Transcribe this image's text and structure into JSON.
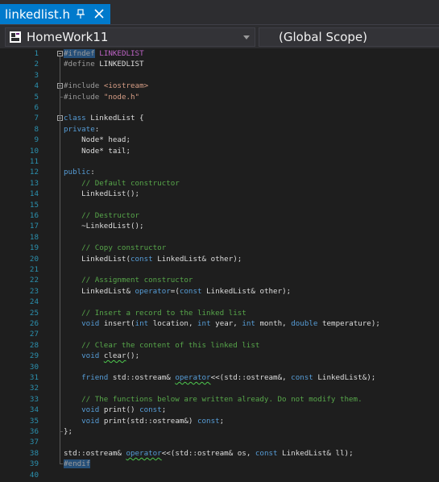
{
  "tab": {
    "title": "linkedlist.h"
  },
  "nav": {
    "project": "HomeWork11",
    "scope": "(Global Scope)"
  },
  "lines": [
    {
      "n": "1",
      "segs": [
        {
          "t": "#ifndef",
          "c": "pp sel"
        },
        {
          "t": " "
        },
        {
          "t": "LINKEDLIST",
          "c": "macro"
        }
      ]
    },
    {
      "n": "2",
      "segs": [
        {
          "t": "#define",
          "c": "pp"
        },
        {
          "t": " LINKEDLIST"
        }
      ]
    },
    {
      "n": "3",
      "segs": []
    },
    {
      "n": "4",
      "segs": [
        {
          "t": "#include",
          "c": "pp"
        },
        {
          "t": " "
        },
        {
          "t": "<iostream>",
          "c": "str"
        }
      ]
    },
    {
      "n": "5",
      "segs": [
        {
          "t": "#include",
          "c": "pp"
        },
        {
          "t": " "
        },
        {
          "t": "\"node.h\"",
          "c": "str"
        }
      ]
    },
    {
      "n": "6",
      "segs": []
    },
    {
      "n": "7",
      "segs": [
        {
          "t": "class",
          "c": "kw"
        },
        {
          "t": " LinkedList {"
        }
      ]
    },
    {
      "n": "8",
      "segs": [
        {
          "t": "private",
          "c": "kw"
        },
        {
          "t": ":"
        }
      ]
    },
    {
      "n": "9",
      "segs": [
        {
          "t": "    Node* head;"
        }
      ]
    },
    {
      "n": "10",
      "segs": [
        {
          "t": "    Node* tail;"
        }
      ]
    },
    {
      "n": "11",
      "segs": []
    },
    {
      "n": "12",
      "segs": [
        {
          "t": "public",
          "c": "kw"
        },
        {
          "t": ":"
        }
      ]
    },
    {
      "n": "13",
      "segs": [
        {
          "t": "    "
        },
        {
          "t": "// Default constructor",
          "c": "cm"
        }
      ]
    },
    {
      "n": "14",
      "segs": [
        {
          "t": "    LinkedList();"
        }
      ]
    },
    {
      "n": "15",
      "segs": []
    },
    {
      "n": "16",
      "segs": [
        {
          "t": "    "
        },
        {
          "t": "// Destructor",
          "c": "cm"
        }
      ]
    },
    {
      "n": "17",
      "segs": [
        {
          "t": "    ~LinkedList();"
        }
      ]
    },
    {
      "n": "18",
      "segs": []
    },
    {
      "n": "19",
      "segs": [
        {
          "t": "    "
        },
        {
          "t": "// Copy constructor",
          "c": "cm"
        }
      ]
    },
    {
      "n": "20",
      "segs": [
        {
          "t": "    LinkedList("
        },
        {
          "t": "const",
          "c": "kw"
        },
        {
          "t": " LinkedList& other);"
        }
      ]
    },
    {
      "n": "21",
      "segs": []
    },
    {
      "n": "22",
      "segs": [
        {
          "t": "    "
        },
        {
          "t": "// Assignment constructor",
          "c": "cm"
        }
      ]
    },
    {
      "n": "23",
      "segs": [
        {
          "t": "    LinkedList& "
        },
        {
          "t": "operator",
          "c": "kw"
        },
        {
          "t": "=("
        },
        {
          "t": "const",
          "c": "kw"
        },
        {
          "t": " LinkedList& other);"
        }
      ]
    },
    {
      "n": "24",
      "segs": []
    },
    {
      "n": "25",
      "segs": [
        {
          "t": "    "
        },
        {
          "t": "// Insert a record to the linked list",
          "c": "cm"
        }
      ]
    },
    {
      "n": "26",
      "segs": [
        {
          "t": "    "
        },
        {
          "t": "void",
          "c": "kw"
        },
        {
          "t": " insert("
        },
        {
          "t": "int",
          "c": "kw"
        },
        {
          "t": " location, "
        },
        {
          "t": "int",
          "c": "kw"
        },
        {
          "t": " year, "
        },
        {
          "t": "int",
          "c": "kw"
        },
        {
          "t": " month, "
        },
        {
          "t": "double",
          "c": "kw"
        },
        {
          "t": " temperature);"
        }
      ]
    },
    {
      "n": "27",
      "segs": []
    },
    {
      "n": "28",
      "segs": [
        {
          "t": "    "
        },
        {
          "t": "// Clear the content of this linked list",
          "c": "cm"
        }
      ]
    },
    {
      "n": "29",
      "segs": [
        {
          "t": "    "
        },
        {
          "t": "void",
          "c": "kw"
        },
        {
          "t": " "
        },
        {
          "t": "clear",
          "c": "squig"
        },
        {
          "t": "();"
        }
      ]
    },
    {
      "n": "30",
      "segs": []
    },
    {
      "n": "31",
      "segs": [
        {
          "t": "    "
        },
        {
          "t": "friend",
          "c": "kw"
        },
        {
          "t": " std::ostream& "
        },
        {
          "t": "operator",
          "c": "kw squig"
        },
        {
          "t": "<<(std::ostream&, "
        },
        {
          "t": "const",
          "c": "kw"
        },
        {
          "t": " LinkedList&);"
        }
      ]
    },
    {
      "n": "32",
      "segs": []
    },
    {
      "n": "33",
      "segs": [
        {
          "t": "    "
        },
        {
          "t": "// The functions below are written already. Do not modify them.",
          "c": "cm"
        }
      ]
    },
    {
      "n": "34",
      "segs": [
        {
          "t": "    "
        },
        {
          "t": "void",
          "c": "kw"
        },
        {
          "t": " print() "
        },
        {
          "t": "const",
          "c": "kw"
        },
        {
          "t": ";"
        }
      ]
    },
    {
      "n": "35",
      "segs": [
        {
          "t": "    "
        },
        {
          "t": "void",
          "c": "kw"
        },
        {
          "t": " print(std::ostream&) "
        },
        {
          "t": "const",
          "c": "kw"
        },
        {
          "t": ";"
        }
      ]
    },
    {
      "n": "36",
      "segs": [
        {
          "t": "};"
        }
      ]
    },
    {
      "n": "37",
      "segs": []
    },
    {
      "n": "38",
      "segs": [
        {
          "t": "std::ostream& "
        },
        {
          "t": "operator",
          "c": "kw squig"
        },
        {
          "t": "<<(std::ostream& os, "
        },
        {
          "t": "const",
          "c": "kw"
        },
        {
          "t": " LinkedList& ll);"
        }
      ]
    },
    {
      "n": "39",
      "segs": [
        {
          "t": "#endif",
          "c": "pp sel"
        }
      ]
    },
    {
      "n": "40",
      "segs": []
    }
  ],
  "folds": [
    1,
    4,
    7
  ],
  "colors": {
    "accent": "#007acc",
    "lineNumber": "#2b91af",
    "keyword": "#569cd6",
    "comment": "#57a64a",
    "string": "#d69d85",
    "macro": "#bd63c5"
  }
}
